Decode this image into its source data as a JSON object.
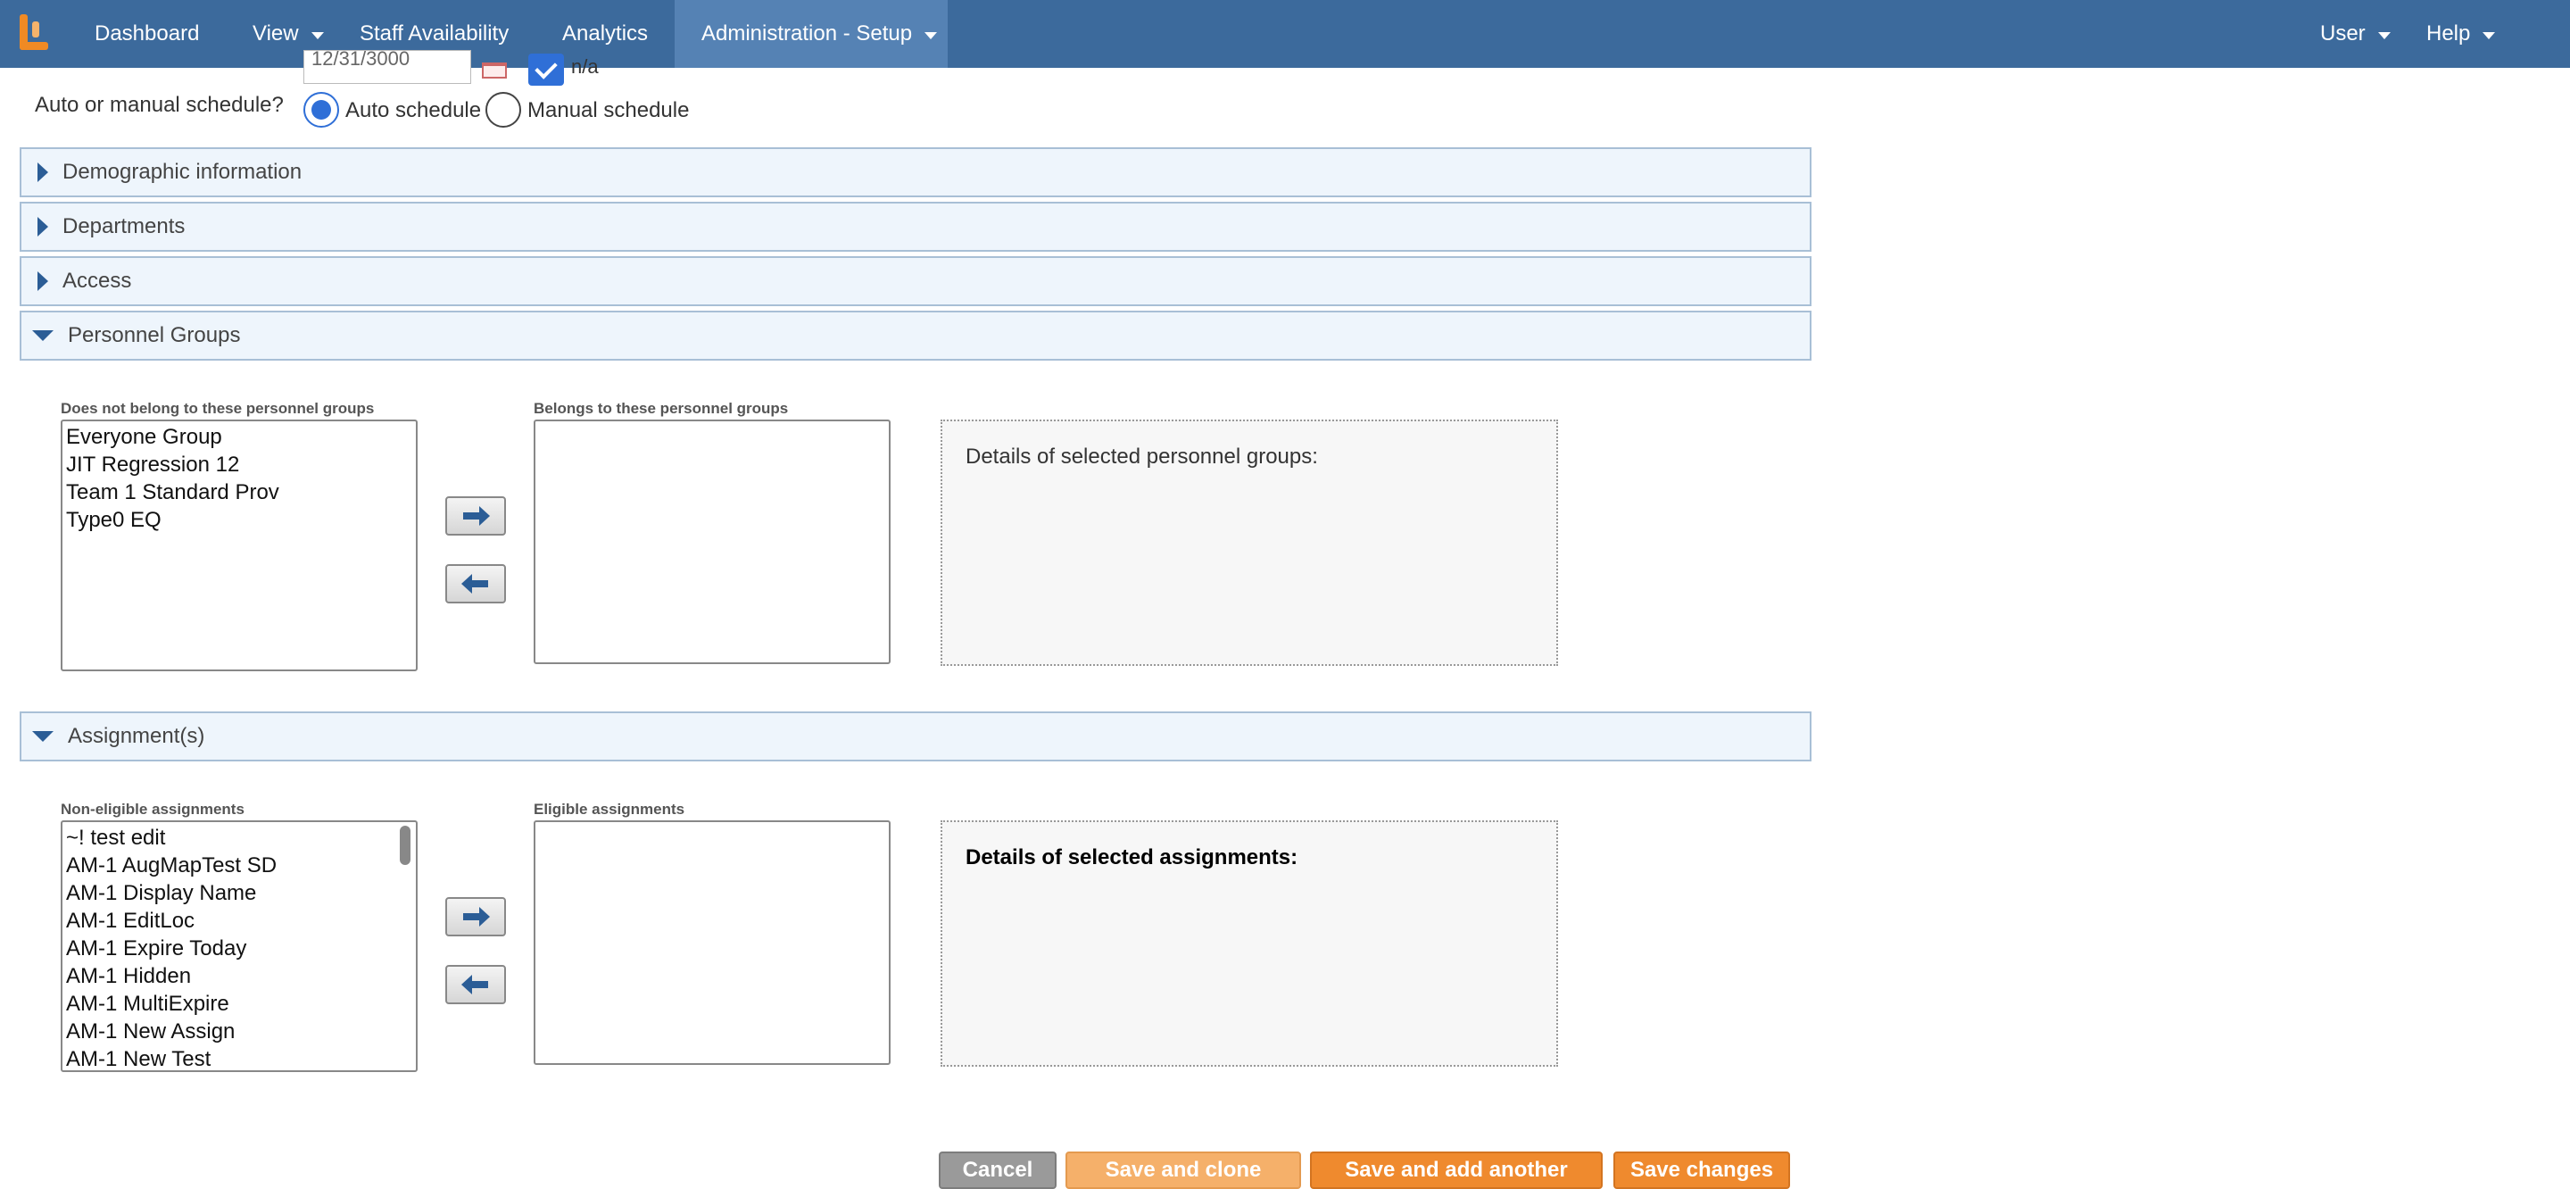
{
  "nav": {
    "items": [
      {
        "label": "Dashboard"
      },
      {
        "label": "View"
      },
      {
        "label": "Staff Availability"
      },
      {
        "label": "Analytics"
      },
      {
        "label": "Administration - Setup"
      }
    ],
    "right": [
      {
        "label": "User"
      },
      {
        "label": "Help"
      }
    ]
  },
  "top_row": {
    "date_value": "12/31/3000",
    "na_label": "n/a"
  },
  "schedule": {
    "label": "Auto or manual schedule?",
    "options": [
      {
        "label": "Auto schedule",
        "selected": true
      },
      {
        "label": "Manual schedule",
        "selected": false
      }
    ]
  },
  "sections": [
    {
      "title": "Demographic information",
      "expanded": false
    },
    {
      "title": "Departments",
      "expanded": false
    },
    {
      "title": "Access",
      "expanded": false
    },
    {
      "title": "Personnel Groups",
      "expanded": true
    },
    {
      "title": "Assignment(s)",
      "expanded": true
    }
  ],
  "personnel_groups": {
    "left_caption": "Does not belong to these personnel groups",
    "right_caption": "Belongs to these personnel groups",
    "left_items": [
      "Everyone Group",
      "JIT Regression 12",
      "Team 1 Standard Prov",
      "Type0 EQ"
    ],
    "right_items": [],
    "details_title": "Details of selected personnel groups:"
  },
  "assignments": {
    "left_caption": "Non-eligible assignments",
    "right_caption": "Eligible assignments",
    "left_items": [
      "~! test edit",
      "AM-1 AugMapTest SD",
      "AM-1 Display Name",
      "AM-1 EditLoc",
      "AM-1 Expire Today",
      "AM-1 Hidden",
      "AM-1 MultiExpire",
      "AM-1 New Assign",
      "AM-1 New Test"
    ],
    "right_items": [],
    "details_title": "Details of selected assignments:"
  },
  "footer": {
    "cancel": "Cancel",
    "save_clone": "Save and clone",
    "save_add": "Save and add another",
    "save_changes": "Save changes"
  },
  "colors": {
    "nav_bg": "#3c6a9c",
    "nav_active": "#5582b4",
    "section_bg": "#eef5fc",
    "accent_orange": "#ef8a2e",
    "light_orange": "#f5b06a",
    "cancel_gray": "#9a9a9a",
    "checked_blue": "#2f6fd7"
  }
}
